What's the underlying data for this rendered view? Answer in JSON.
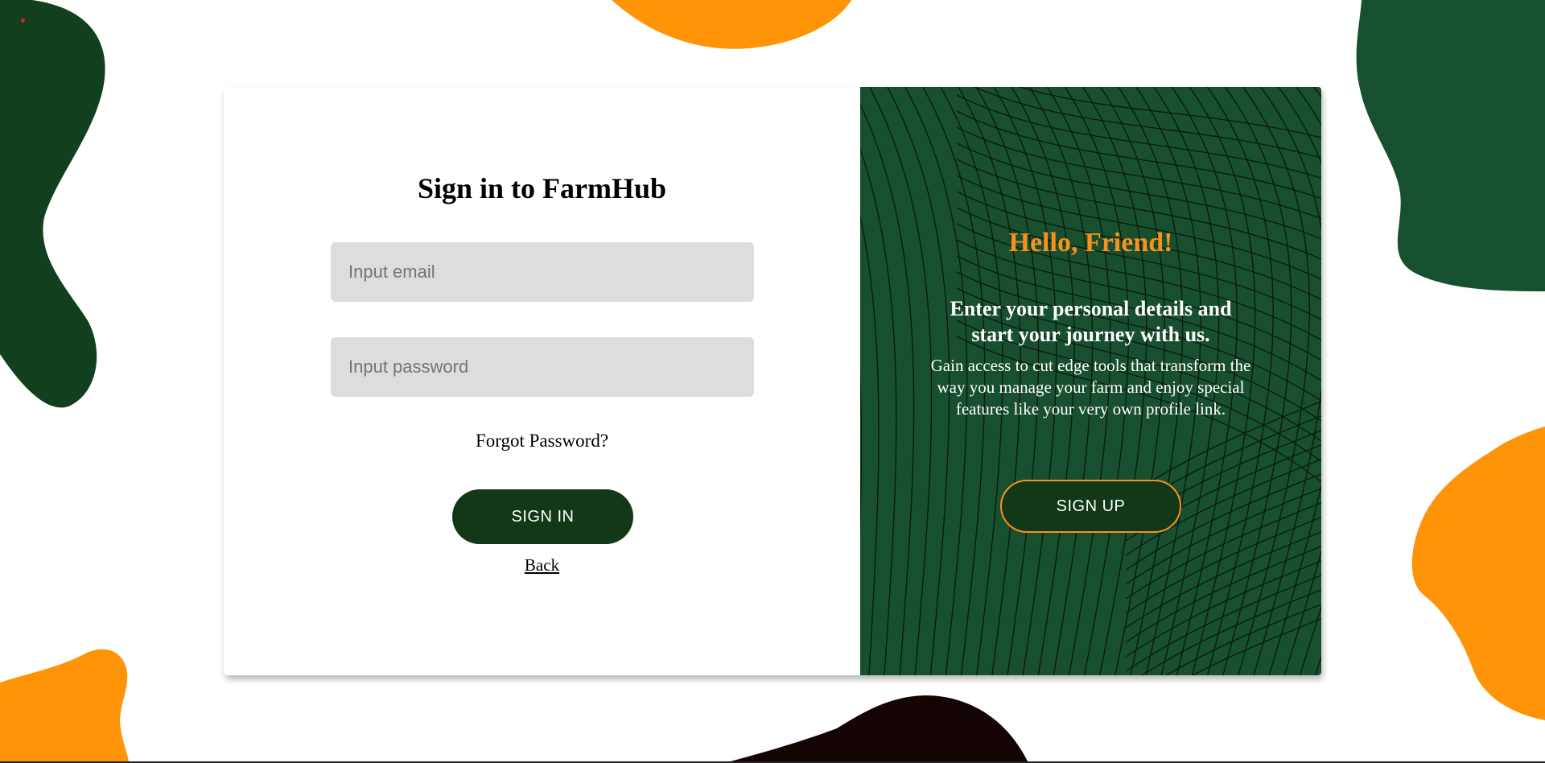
{
  "colors": {
    "dark_green": "#123818",
    "panel_green": "#18502f",
    "blob_green": "#16502f",
    "orange": "#ff9408",
    "accent_orange": "#f6921e",
    "input_gray": "#dddddd",
    "dark_brown": "#140404"
  },
  "signin": {
    "title": "Sign in to FarmHub",
    "email_placeholder": "Input email",
    "password_placeholder": "Input password",
    "forgot_label": "Forgot Password?",
    "button_label": "SIGN IN",
    "back_label": "Back"
  },
  "welcome": {
    "heading": "Hello, Friend!",
    "subheading": "Enter your personal details and start your journey with us.",
    "body": "Gain access to cut edge tools that transform the way you manage your farm and enjoy special features like your very own profile link.",
    "button_label": "SIGN UP"
  }
}
